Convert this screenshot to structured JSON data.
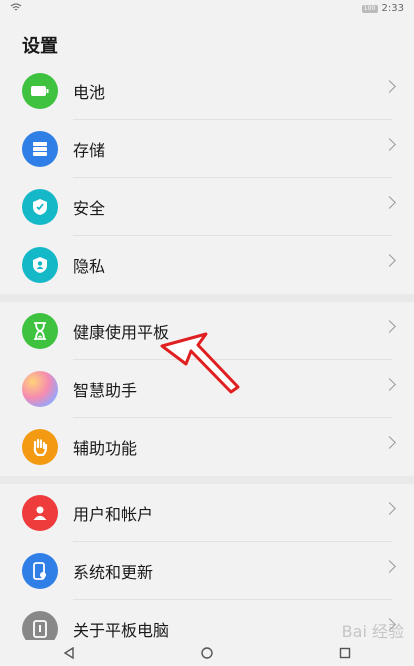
{
  "status": {
    "battery": "100",
    "time": "2:33"
  },
  "title": "设置",
  "groups": [
    [
      {
        "label": "电池",
        "color": "#3fc23f",
        "icon": "battery-icon"
      },
      {
        "label": "存储",
        "color": "#2f7fe6",
        "icon": "storage-icon"
      },
      {
        "label": "安全",
        "color": "#15b8c7",
        "icon": "shield-icon"
      },
      {
        "label": "隐私",
        "color": "#15b8c7",
        "icon": "privacy-icon"
      }
    ],
    [
      {
        "label": "健康使用平板",
        "color": "#3fc23f",
        "icon": "hourglass-icon"
      },
      {
        "label": "智慧助手",
        "color": "gradient",
        "icon": "assistant-icon"
      },
      {
        "label": "辅助功能",
        "color": "#f39a12",
        "icon": "hand-icon"
      }
    ],
    [
      {
        "label": "用户和帐户",
        "color": "#ee3b3b",
        "icon": "user-icon"
      },
      {
        "label": "系统和更新",
        "color": "#2f7fe6",
        "icon": "system-update-icon"
      },
      {
        "label": "关于平板电脑",
        "color": "#888888",
        "icon": "tablet-icon"
      }
    ]
  ],
  "watermark": "Bai 经验"
}
